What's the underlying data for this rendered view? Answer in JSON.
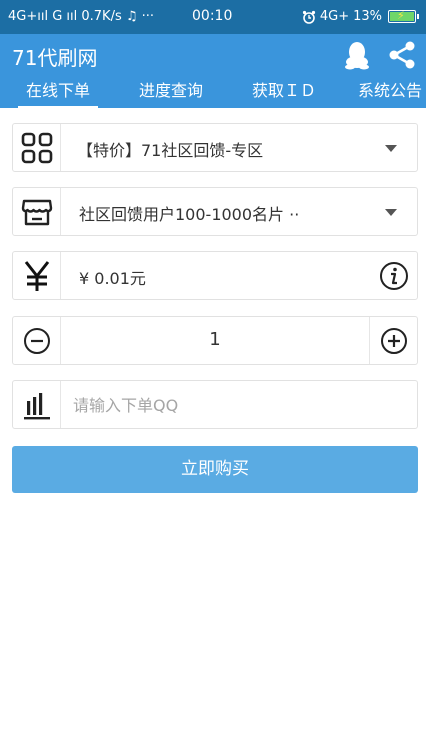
{
  "status_bar": {
    "left": "4G+ııl G ııl 0.7K/s ♫ ···",
    "time": "00:10",
    "network": "4G+",
    "battery": "13%"
  },
  "app": {
    "title": "71代刷网"
  },
  "tabs": [
    {
      "label": "在线下单",
      "active": true
    },
    {
      "label": "进度查询",
      "active": false
    },
    {
      "label": "获取ＩＤ",
      "active": false
    },
    {
      "label": "系统公告",
      "active": false
    }
  ],
  "form": {
    "category": "【特价】71社区回馈-专区",
    "product": "社区回馈用户100-1000名片 ··",
    "price": "¥ 0.01元",
    "quantity": "1",
    "qq_placeholder": "请输入下单QQ",
    "buy_label": "立即购买"
  },
  "colors": {
    "status_bar": "#1c6ea4",
    "app_bar": "#3a95dc",
    "buy_button": "#5aabe3"
  }
}
